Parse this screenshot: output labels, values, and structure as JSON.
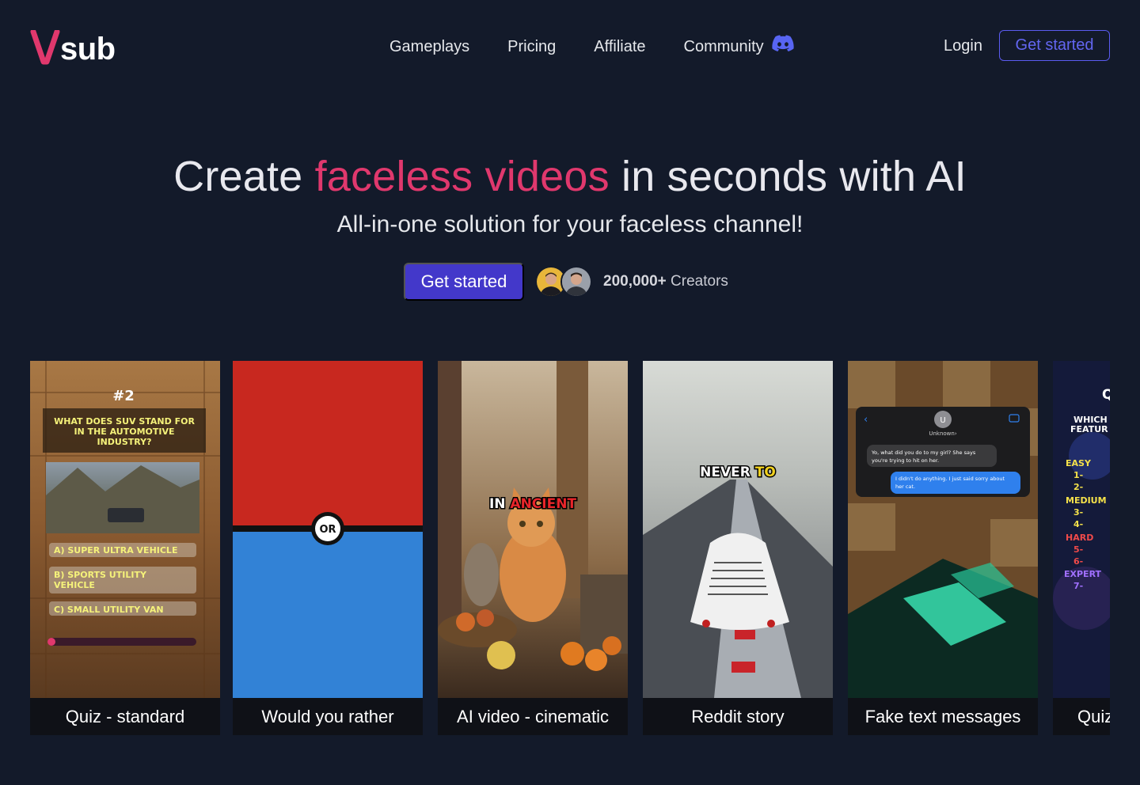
{
  "brand": {
    "logo_text": "sub",
    "accent_color": "#e0386d",
    "primary_color": "#4338ca"
  },
  "nav": {
    "items": [
      {
        "label": "Gameplays"
      },
      {
        "label": "Pricing"
      },
      {
        "label": "Affiliate"
      },
      {
        "label": "Community",
        "icon": "discord-icon"
      }
    ],
    "login_label": "Login",
    "get_started_label": "Get started"
  },
  "hero": {
    "title_before": "Create ",
    "title_accent": "faceless videos",
    "title_after": " in seconds with AI",
    "subtitle": "All-in-one solution for your faceless channel!",
    "cta_label": "Get started",
    "creators_count": "200,000+",
    "creators_label": " Creators"
  },
  "cards": [
    {
      "label": "Quiz - standard",
      "overlay": {
        "number": "#2",
        "question": [
          "WHAT DOES SUV STAND FOR",
          "IN THE AUTOMOTIVE",
          "INDUSTRY?"
        ],
        "options": [
          "A) SUPER ULTRA VEHICLE",
          "B) SPORTS UTILITY",
          "VEHICLE",
          "C) SMALL UTILITY VAN"
        ]
      }
    },
    {
      "label": "Would you rather",
      "overlay": {
        "badge": "OR"
      }
    },
    {
      "label": "AI video - cinematic",
      "overlay": {
        "caption_a": "IN ",
        "caption_b": "ANCIENT"
      }
    },
    {
      "label": "Reddit story",
      "overlay": {
        "caption_a": "NEVER ",
        "caption_b": "TO"
      }
    },
    {
      "label": "Fake text messages",
      "overlay": {
        "contact_initial": "U",
        "contact_name": "Unknown›",
        "message_in": [
          "Yo, what did you do to my girl? She says",
          "you're trying to hit on her."
        ],
        "message_out": [
          "I didn't do anything. I just said sorry about",
          "her cat."
        ]
      }
    },
    {
      "label": "Quiz",
      "overlay": {
        "title": "Q",
        "question": [
          "WHICH",
          "FEATUR"
        ],
        "levels": [
          "EASY",
          "1-",
          "2-",
          "MEDIUM",
          "3-",
          "4-",
          "HARD",
          "5-",
          "6-",
          "EXPERT",
          "7-"
        ]
      }
    }
  ]
}
